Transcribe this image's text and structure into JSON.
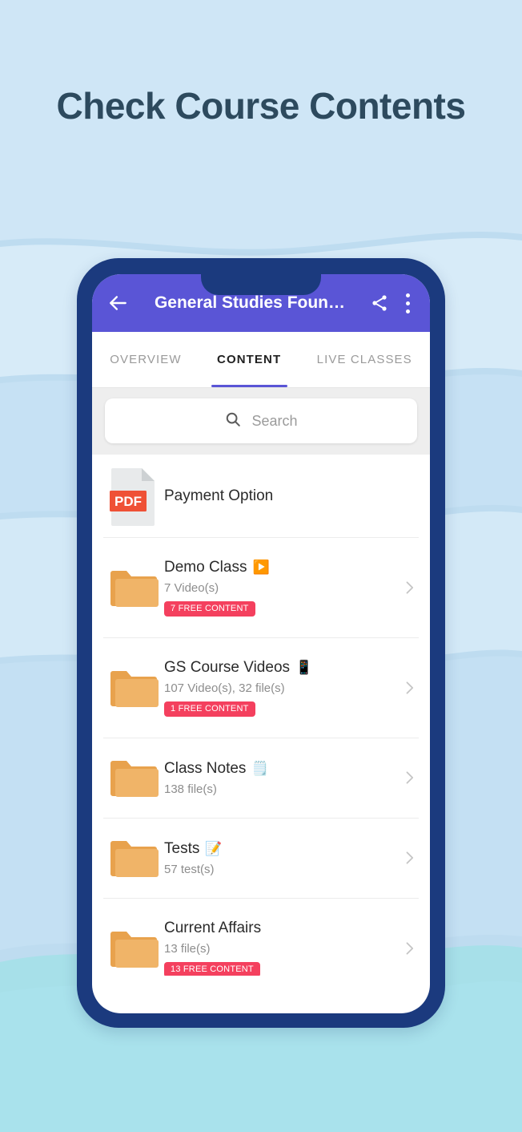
{
  "page": {
    "headline": "Check Course Contents",
    "background_color": "#bedcf0",
    "accent_color": "#5a55d6",
    "frame_color": "#1b3a7e",
    "badge_color": "#f4405e",
    "folder_color": "#eeab5b"
  },
  "appbar": {
    "title": "General Studies Foun…",
    "back_icon": "arrow-left-icon",
    "share_icon": "share-icon",
    "menu_icon": "overflow-menu-icon"
  },
  "tabs": [
    {
      "label": "OVERVIEW",
      "active": false
    },
    {
      "label": "CONTENT",
      "active": true
    },
    {
      "label": "LIVE CLASSES",
      "active": false
    }
  ],
  "search": {
    "icon": "search-icon",
    "placeholder": "Search",
    "value": ""
  },
  "content_items": [
    {
      "type": "pdf",
      "icon": "pdf-file-icon",
      "icon_label": "PDF",
      "title": "Payment Option",
      "emoji": "",
      "subtitle": "",
      "badge": "",
      "chevron": false
    },
    {
      "type": "folder",
      "icon": "folder-icon",
      "title": "Demo Class",
      "emoji": "▶️",
      "subtitle": "7 Video(s)",
      "badge": "7 FREE CONTENT",
      "chevron": true
    },
    {
      "type": "folder",
      "icon": "folder-icon",
      "title": "GS Course Videos",
      "emoji": "📱",
      "subtitle": "107 Video(s), 32 file(s)",
      "badge": "1 FREE CONTENT",
      "chevron": true
    },
    {
      "type": "folder",
      "icon": "folder-icon",
      "title": "Class Notes",
      "emoji": "🗒️",
      "subtitle": "138 file(s)",
      "badge": "",
      "chevron": true
    },
    {
      "type": "folder",
      "icon": "folder-icon",
      "title": "Tests",
      "emoji": "📝",
      "subtitle": "57 test(s)",
      "badge": "",
      "chevron": true
    },
    {
      "type": "folder",
      "icon": "folder-icon",
      "title": "Current Affairs",
      "emoji": "",
      "subtitle": "13 file(s)",
      "badge": "13 FREE CONTENT",
      "chevron": true
    }
  ]
}
